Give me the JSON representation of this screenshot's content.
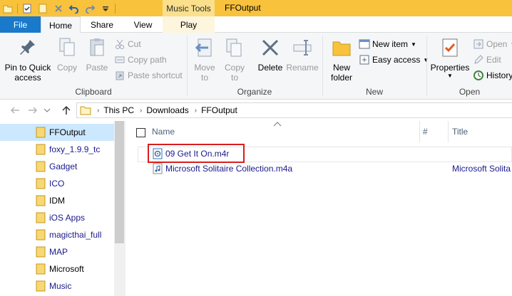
{
  "window": {
    "title": "FFOutput",
    "context_tab_header": "Music Tools"
  },
  "quick_access_toolbar": {
    "icons": [
      "folder-icon",
      "checkmark-properties-icon",
      "new-folder-icon",
      "delete-x-icon",
      "undo-icon",
      "redo-icon",
      "dropdown-arrow-icon"
    ]
  },
  "tabs": {
    "file": "File",
    "home": "Home",
    "share": "Share",
    "view": "View",
    "play": "Play"
  },
  "ribbon": {
    "clipboard": {
      "label": "Clipboard",
      "pin_label_1": "Pin to Quick",
      "pin_label_2": "access",
      "copy": "Copy",
      "paste": "Paste",
      "cut": "Cut",
      "copy_path": "Copy path",
      "paste_shortcut": "Paste shortcut"
    },
    "organize": {
      "label": "Organize",
      "move_to_1": "Move",
      "move_to_2": "to",
      "copy_to_1": "Copy",
      "copy_to_2": "to",
      "delete": "Delete",
      "rename": "Rename"
    },
    "new": {
      "label": "New",
      "new_folder_1": "New",
      "new_folder_2": "folder",
      "new_item": "New item",
      "easy_access": "Easy access"
    },
    "open": {
      "label": "Open",
      "properties": "Properties",
      "open": "Open",
      "edit": "Edit",
      "history": "History"
    }
  },
  "address": {
    "crumbs": [
      "This PC",
      "Downloads",
      "FFOutput"
    ]
  },
  "nav_pane": {
    "items": [
      {
        "label": "FFOutput",
        "selected": true,
        "linked": false
      },
      {
        "label": "foxy_1.9.9_tc",
        "selected": false,
        "linked": true
      },
      {
        "label": "Gadget",
        "selected": false,
        "linked": true
      },
      {
        "label": "ICO",
        "selected": false,
        "linked": true
      },
      {
        "label": "IDM",
        "selected": false,
        "linked": false
      },
      {
        "label": "iOS Apps",
        "selected": false,
        "linked": true
      },
      {
        "label": "magicthai_full",
        "selected": false,
        "linked": true
      },
      {
        "label": "MAP",
        "selected": false,
        "linked": true
      },
      {
        "label": "Microsoft",
        "selected": false,
        "linked": false
      },
      {
        "label": "Music",
        "selected": false,
        "linked": true
      }
    ]
  },
  "file_list": {
    "columns": {
      "name": "Name",
      "number": "#",
      "title": "Title"
    },
    "files": [
      {
        "name": "09 Get It On.m4r",
        "title": ""
      },
      {
        "name": "Microsoft Solitaire Collection.m4a",
        "title": "Microsoft Solita"
      }
    ]
  },
  "colors": {
    "title_bar": "#f8c23d",
    "file_tab": "#1979ca",
    "selection": "#cce8ff",
    "highlight_box": "#d81e1e",
    "link_text": "#1a1a8a"
  }
}
